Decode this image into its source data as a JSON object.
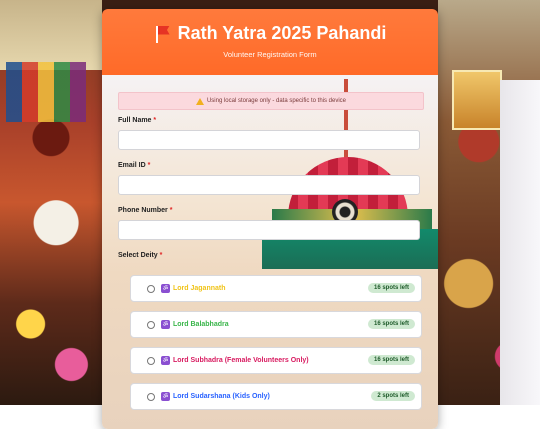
{
  "header": {
    "title": "Rath Yatra 2025 Pahandi",
    "subtitle": "Volunteer Registration Form",
    "flag_icon": "red-flag-icon"
  },
  "notice": {
    "text": "Using local storage only - data specific to this device",
    "icon": "warning-icon"
  },
  "form": {
    "full_name": {
      "label": "Full Name",
      "required_mark": "*",
      "value": ""
    },
    "email": {
      "label": "Email ID",
      "required_mark": "*",
      "value": ""
    },
    "phone": {
      "label": "Phone Number",
      "required_mark": "*",
      "value": ""
    },
    "deity": {
      "label": "Select Deity",
      "required_mark": "*",
      "options": [
        {
          "icon": "ॐ",
          "name": "Lord Jagannath",
          "spots": "16 spots left",
          "color": "#f0c419"
        },
        {
          "icon": "ॐ",
          "name": "Lord Balabhadra",
          "spots": "16 spots left",
          "color": "#39b54a"
        },
        {
          "icon": "ॐ",
          "name": "Lord Subhadra (Female Volunteers Only)",
          "spots": "16 spots left",
          "color": "#d81b60"
        },
        {
          "icon": "ॐ",
          "name": "Lord Sudarshana (Kids Only)",
          "spots": "2 spots left",
          "color": "#2962ff"
        }
      ]
    }
  },
  "colors": {
    "header": "#ff6a28",
    "notice_bg": "#fbd9de",
    "spots_bg": "#cfe9d1",
    "required": "#e02424"
  }
}
